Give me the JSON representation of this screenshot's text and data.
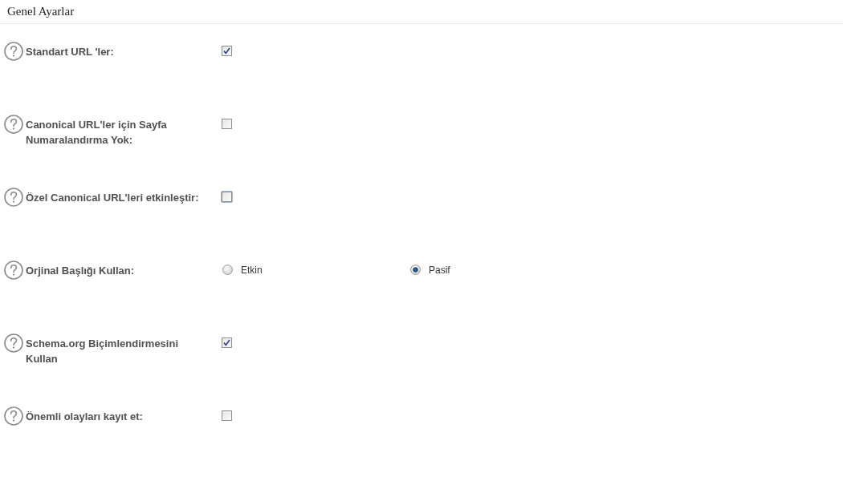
{
  "header": {
    "title": "Genel Ayarlar"
  },
  "settings": [
    {
      "kind": "checkbox",
      "label": "Standart URL 'ler:",
      "checked": true,
      "focused": false
    },
    {
      "kind": "checkbox",
      "label": "Canonical URL'ler için Sayfa Numaralandırma Yok:",
      "checked": false,
      "focused": false
    },
    {
      "kind": "checkbox",
      "label": "Özel Canonical URL'leri etkinleştir:",
      "checked": false,
      "focused": true
    },
    {
      "kind": "radio",
      "label": "Orjinal Başlığı Kullan:",
      "focused": false,
      "options": [
        {
          "label": "Etkin",
          "selected": false
        },
        {
          "label": "Pasif",
          "selected": true
        }
      ]
    },
    {
      "kind": "checkbox",
      "label": "Schema.org Biçimlendirmesini Kullan",
      "checked": true,
      "focused": false
    },
    {
      "kind": "checkbox",
      "label": "Önemli olayları kayıt et:",
      "checked": false,
      "focused": false
    }
  ]
}
